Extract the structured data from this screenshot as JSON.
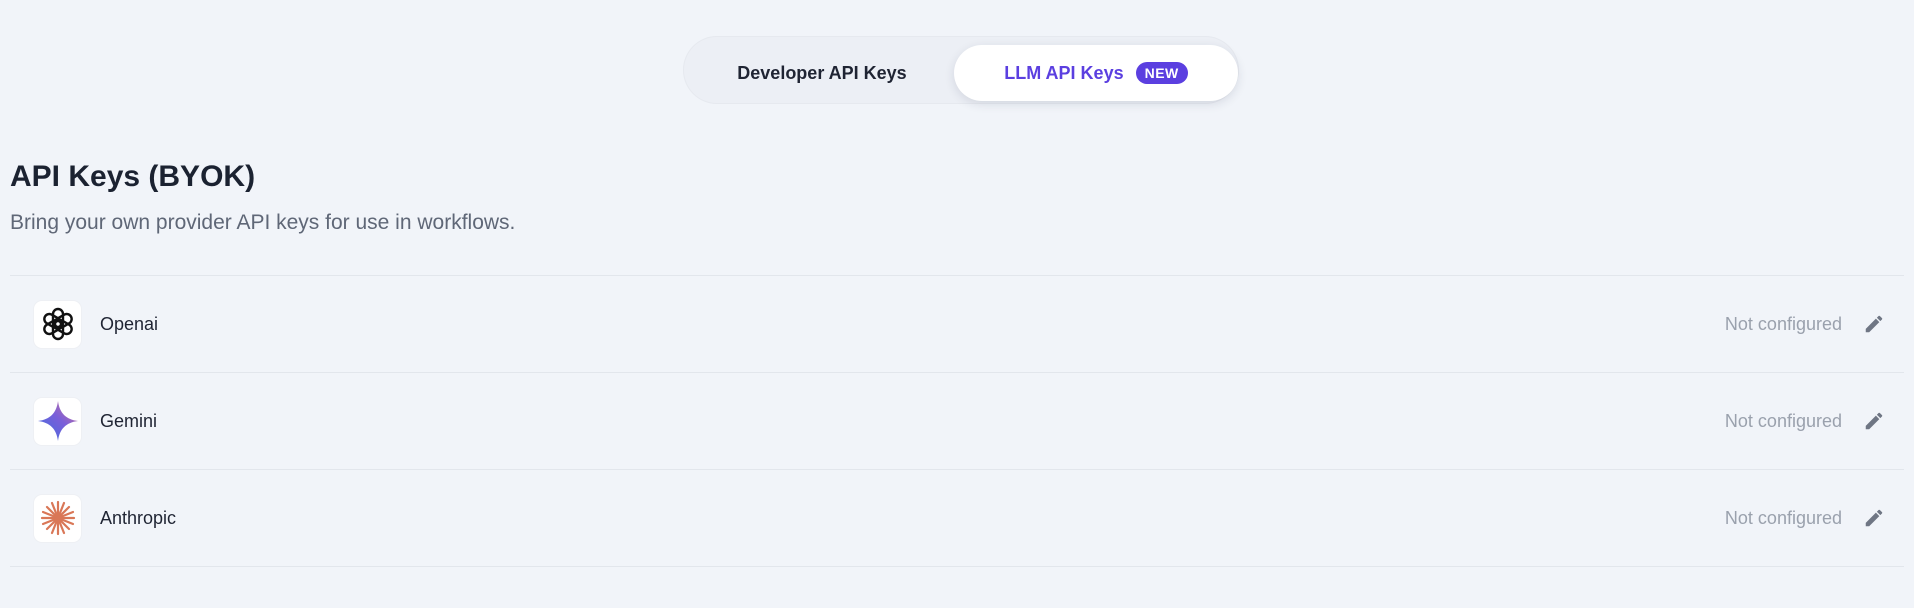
{
  "tabs": {
    "developer_label": "Developer API Keys",
    "llm_label": "LLM API Keys",
    "llm_badge": "NEW",
    "active": "llm"
  },
  "header": {
    "title": "API Keys (BYOK)",
    "subtitle": "Bring your own provider API keys for use in workflows."
  },
  "providers": [
    {
      "name": "Openai",
      "status": "Not configured",
      "icon": "openai-logo-icon"
    },
    {
      "name": "Gemini",
      "status": "Not configured",
      "icon": "gemini-logo-icon"
    },
    {
      "name": "Anthropic",
      "status": "Not configured",
      "icon": "anthropic-logo-icon"
    }
  ],
  "colors": {
    "accent": "#5b3fe0",
    "background": "#f1f4f9",
    "anthropic": "#d97757"
  }
}
